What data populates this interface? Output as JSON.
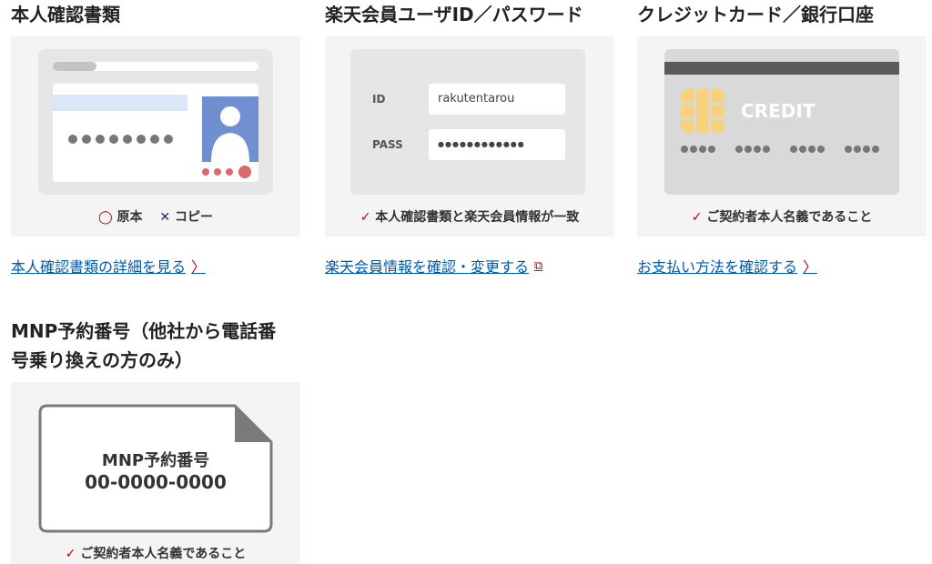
{
  "cards": [
    {
      "title": "本人確認書類",
      "ok_label": "原本",
      "ng_label": "コピー",
      "link": "本人確認書類の詳細を見る"
    },
    {
      "title": "楽天会員ユーザID／パスワード",
      "id_label": "ID",
      "id_value": "rakutentarou",
      "pass_label": "PASS",
      "pass_value": "●●●●●●●●●●●●",
      "check_text": "本人確認書類と楽天会員情報が一致",
      "link": "楽天会員情報を確認・変更する"
    },
    {
      "title": "クレジットカード／銀行口座",
      "card_label": "CREDIT",
      "check_text": "ご契約者本人名義であること",
      "link": "お支払い方法を確認する"
    },
    {
      "title_line1": "MNP予約番号（他社から電話番",
      "title_line2": "号乗り換えの方のみ）",
      "doc_title": "MNP予約番号",
      "doc_number": "00-0000-0000",
      "check_text": "ご契約者本人名義であること"
    }
  ],
  "colors": {
    "accent": "#bf0000",
    "link": "#0058a8",
    "panel_bg": "#f4f4f4",
    "id_photo": "#6f8fd0",
    "id_stripe": "#d9e7f7",
    "chip": "#f7d27a",
    "card_gray": "#d9d9d9",
    "magstripe": "#5a5a5a"
  }
}
